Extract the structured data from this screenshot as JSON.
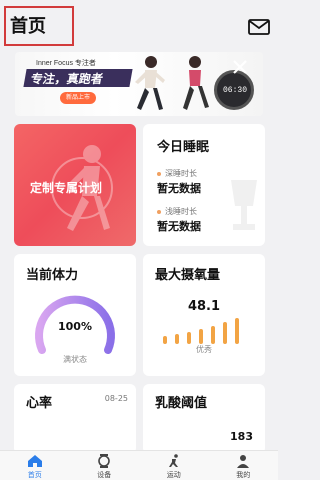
{
  "header": {
    "title": "首页",
    "mail_icon": "mail-icon"
  },
  "banner": {
    "brand": "Inner Focus 专注者",
    "slogan": "专注，真跑者",
    "tag": "新品上市",
    "watch_time": "06:30",
    "close_icon": "close-icon"
  },
  "plan_card": {
    "label": "定制专属计划",
    "color": "#ee4d5a"
  },
  "sleep_card": {
    "title": "今日睡眠",
    "deep_label": "深睡时长",
    "deep_value": "暂无数据",
    "light_label": "浅睡时长",
    "light_value": "暂无数据"
  },
  "stamina_card": {
    "title": "当前体力",
    "value": "100%",
    "status": "满状态",
    "progress": 1.0
  },
  "vo2_card": {
    "title": "最大摄氧量",
    "value": "48.1",
    "status": "优秀"
  },
  "hr_card": {
    "title": "心率",
    "date": "08-25"
  },
  "lactate_card": {
    "title": "乳酸阈值",
    "value": "183"
  },
  "bottom_nav": {
    "items": [
      {
        "label": "首页",
        "icon": "home-icon",
        "active": true
      },
      {
        "label": "设备",
        "icon": "watch-icon",
        "active": false
      },
      {
        "label": "运动",
        "icon": "running-icon",
        "active": false
      },
      {
        "label": "我的",
        "icon": "person-icon",
        "active": false
      }
    ],
    "active_color": "#2b7de9"
  }
}
